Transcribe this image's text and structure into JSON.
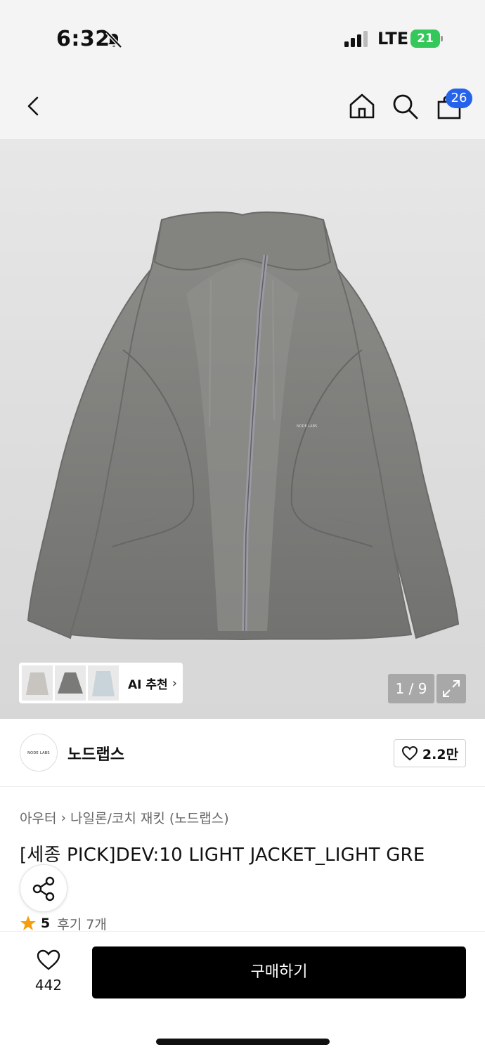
{
  "status_bar": {
    "time": "6:32",
    "network": "LTE",
    "battery": "21"
  },
  "header": {
    "cart_count": "26",
    "icons": [
      "back-icon",
      "home-icon",
      "search-icon",
      "bag-icon"
    ]
  },
  "gallery": {
    "ai_label": "AI 추천",
    "ai_chevron": "›",
    "counter": "1 / 9"
  },
  "brand": {
    "logo_text": "NODE LABS",
    "name": "노드랩스",
    "likes": "2.2만"
  },
  "breadcrumb": {
    "category": "아우터",
    "separator": "›",
    "subcategory": "나일론/코치 재킷 (노드랩스)"
  },
  "product": {
    "title": "[세종 PICK]DEV:10 LIGHT JACKET_LIGHT GRE",
    "rating": "5",
    "reviews": "후기 7개",
    "jacket_print": "NODE LABS"
  },
  "bottom_bar": {
    "wish_count": "442",
    "buy_label": "구매하기"
  },
  "colors": {
    "accent_badge": "#2563eb",
    "battery": "#34c759",
    "star": "#f59e0b",
    "jacket": "#7d7d7b"
  }
}
